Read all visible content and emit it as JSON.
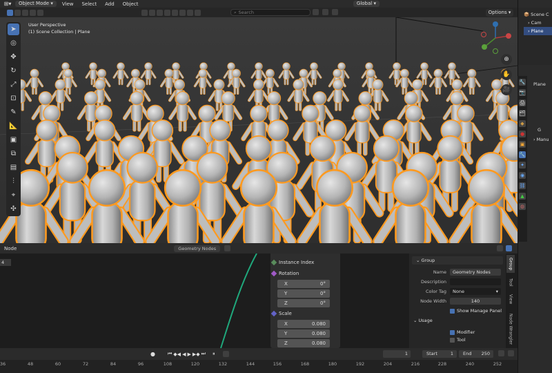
{
  "header": {
    "mode": "Object Mode",
    "menus": [
      "View",
      "Select",
      "Add",
      "Object"
    ],
    "orientation": "Global"
  },
  "search": {
    "placeholder": "Search"
  },
  "options_label": "Options",
  "viewport": {
    "perspective": "User Perspective",
    "collection": "(1) Scene Collection | Plane"
  },
  "outliner": {
    "root": "Scene C",
    "items": [
      "Cam",
      "Plane"
    ]
  },
  "properties": {
    "object_name": "Plane",
    "modifier_short": "G",
    "manage": "Manu"
  },
  "node_editor": {
    "header_label": "Node",
    "tree_name": "Geometry Nodes",
    "frame_field": "4"
  },
  "node": {
    "instance_index": "Instance Index",
    "rotation_label": "Rotation",
    "rotation": [
      {
        "axis": "X",
        "value": "0°"
      },
      {
        "axis": "Y",
        "value": "0°"
      },
      {
        "axis": "Z",
        "value": "0°"
      }
    ],
    "scale_label": "Scale",
    "scale": [
      {
        "axis": "X",
        "value": "0.080"
      },
      {
        "axis": "Y",
        "value": "0.080"
      },
      {
        "axis": "Z",
        "value": "0.080"
      }
    ]
  },
  "side_panel": {
    "group_title": "Group",
    "name_label": "Name",
    "name_value": "Geometry Nodes",
    "description_label": "Description",
    "description_value": "",
    "color_tag_label": "Color Tag",
    "color_tag_value": "None",
    "node_width_label": "Node Width",
    "node_width_value": "140",
    "show_manage_panel": "Show Manage Panel",
    "usage_title": "Usage",
    "modifier": "Modifier",
    "tool": "Tool",
    "tabs": [
      "Group",
      "Tool",
      "View",
      "Node Wrangler"
    ]
  },
  "timeline": {
    "current_frame": "1",
    "start_label": "Start",
    "start": "1",
    "end_label": "End",
    "end": "250",
    "ticks": [
      "36",
      "48",
      "60",
      "72",
      "84",
      "96",
      "108",
      "120",
      "132",
      "144",
      "156",
      "168",
      "180",
      "192",
      "204",
      "216",
      "228",
      "240",
      "252"
    ]
  },
  "colors": {
    "accent": "#4772b3",
    "selection_outline": "#ff9a1f",
    "float_socket": "#a1a1a1",
    "vector_socket": "#6363c7",
    "int_socket": "#598c5c",
    "link": "#1fa87c"
  }
}
